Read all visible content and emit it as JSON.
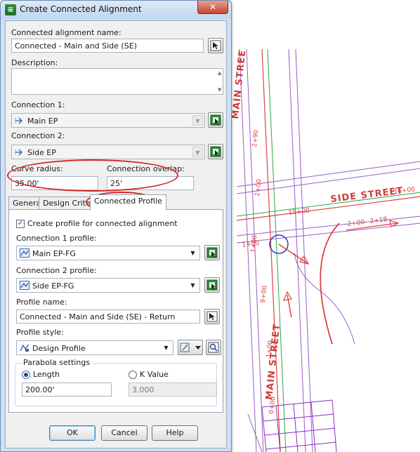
{
  "window": {
    "title": "Create Connected Alignment",
    "close_glyph": "✕"
  },
  "fields": {
    "alignment_name_label": "Connected alignment name:",
    "alignment_name_value": "Connected - Main and Side (SE)",
    "description_label": "Description:",
    "description_value": "",
    "connection1_label": "Connection 1:",
    "connection1_value": "Main EP",
    "connection2_label": "Connection 2:",
    "connection2_value": "Side EP",
    "curve_radius_label": "Curve radius:",
    "curve_radius_value": "35.00'",
    "overlap_label": "Connection overlap:",
    "overlap_value": "25'"
  },
  "tabs": [
    {
      "label": "General",
      "active": false
    },
    {
      "label": "Design Criteria",
      "active": false
    },
    {
      "label": "Connected Profile",
      "active": true
    }
  ],
  "profile_tab": {
    "create_profile_label": "Create profile for connected alignment",
    "create_profile_checked": true,
    "conn1_profile_label": "Connection 1 profile:",
    "conn1_profile_value": "Main EP-FG",
    "conn2_profile_label": "Connection 2 profile:",
    "conn2_profile_value": "Side EP-FG",
    "profile_name_label": "Profile name:",
    "profile_name_value": "Connected - Main and Side (SE) - Return",
    "profile_style_label": "Profile style:",
    "profile_style_value": "Design Profile",
    "parabola_group_label": "Parabola settings",
    "length_label": "Length",
    "length_value": "200.00'",
    "kvalue_label": "K Value",
    "kvalue_value": "3.000",
    "selected_parabola": "Length"
  },
  "buttons": {
    "ok": "OK",
    "cancel": "Cancel",
    "help": "Help"
  },
  "icons": {
    "pick": "pick-from-drawing-icon",
    "alignment": "alignment-icon",
    "profile": "profile-icon",
    "edit_style": "edit-style-icon",
    "preview": "preview-icon"
  },
  "colors": {
    "highlight": "#d22a2a",
    "street_line": "#e04040",
    "offset_line": "#9a5cc8",
    "centerline": "#2aa84a"
  },
  "drawing": {
    "main_street": "MAIN STREET",
    "side_street": "SIDE STREET",
    "stations": [
      "2+90",
      "2+00",
      "1+00",
      "9+00",
      "1+00",
      "0+00",
      "15+00",
      "16+00",
      "2+00",
      "2+18",
      "1+00"
    ]
  }
}
